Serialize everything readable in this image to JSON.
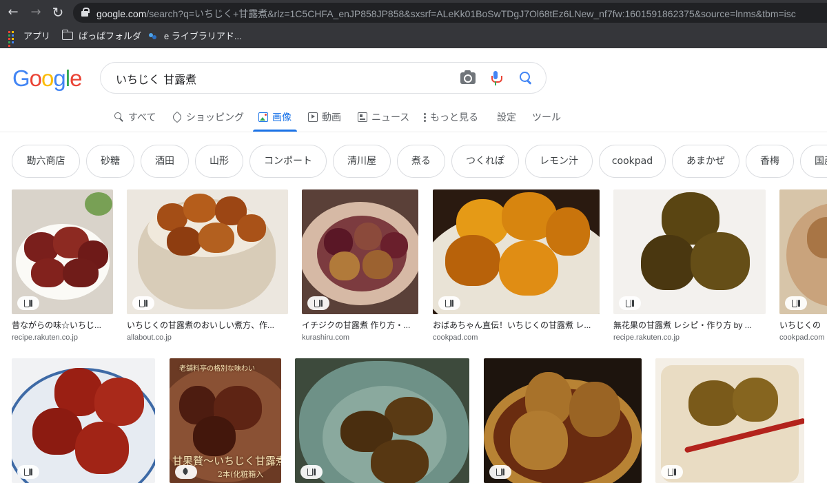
{
  "browser": {
    "url_host": "google.com",
    "url_rest": "/search?q=いちじく+甘露煮&rlz=1C5CHFA_enJP858JP858&sxsrf=ALeKk01BoSwTDgJ7Ol68tEz6LNew_nf7fw:1601591862375&source=lnms&tbm=isc",
    "back_glyph": "←",
    "forward_glyph": "→",
    "reload_glyph": "↻",
    "bookmarks": [
      "アプリ",
      "ぱっぱフォルダ",
      "e ライブラリアド..."
    ]
  },
  "logo": {
    "letters": [
      "G",
      "o",
      "o",
      "g",
      "l",
      "e"
    ],
    "colors": [
      "#4285f4",
      "#ea4335",
      "#fbbc05",
      "#4285f4",
      "#34a853",
      "#ea4335"
    ]
  },
  "search": {
    "query": "いちじく 甘露煮"
  },
  "tabs": [
    {
      "label": "すべて",
      "icon": "search-icon"
    },
    {
      "label": "ショッピング",
      "icon": "tag-icon"
    },
    {
      "label": "画像",
      "icon": "image-icon",
      "active": true
    },
    {
      "label": "動画",
      "icon": "video-icon"
    },
    {
      "label": "ニュース",
      "icon": "news-icon"
    },
    {
      "label": "もっと見る",
      "icon": "more-vert-icon"
    }
  ],
  "tools": {
    "settings": "設定",
    "tools": "ツール"
  },
  "chips": [
    "勘六商店",
    "砂糖",
    "酒田",
    "山形",
    "コンポート",
    "清川屋",
    "煮る",
    "つくれぽ",
    "レモン汁",
    "cookpad",
    "あまかぜ",
    "香梅",
    "国産"
  ],
  "results_row1": [
    {
      "title": "昔ながらの味☆いちじ...",
      "source": "recipe.rakuten.co.jp",
      "badge": "fork-knife-icon"
    },
    {
      "title": "いちじくの甘露煮のおいしい煮方、作...",
      "source": "allabout.co.jp",
      "badge": "fork-knife-icon"
    },
    {
      "title": "イチジクの甘露煮 作り方・...",
      "source": "kurashiru.com",
      "badge": "fork-knife-icon"
    },
    {
      "title": "おばあちゃん直伝！いちじくの甘露煮 レ...",
      "source": "cookpad.com",
      "badge": "fork-knife-icon"
    },
    {
      "title": "無花果の甘露煮 レシピ・作り方 by ...",
      "source": "recipe.rakuten.co.jp",
      "badge": "fork-knife-icon"
    },
    {
      "title": "いちじくの",
      "source": "cookpad.com",
      "badge": "fork-knife-icon"
    }
  ],
  "results_row2": [
    {
      "badge": "fork-knife-icon"
    },
    {
      "badge": "tag-icon",
      "overlay_top": "老舗料亭の格別な味わい",
      "overlay_main": "甘果贅～いちじく甘露煮",
      "overlay_sub": "2本(化粧箱入"
    },
    {
      "badge": "fork-knife-icon"
    },
    {
      "badge": "fork-knife-icon"
    },
    {
      "badge": "fork-knife-icon"
    }
  ]
}
